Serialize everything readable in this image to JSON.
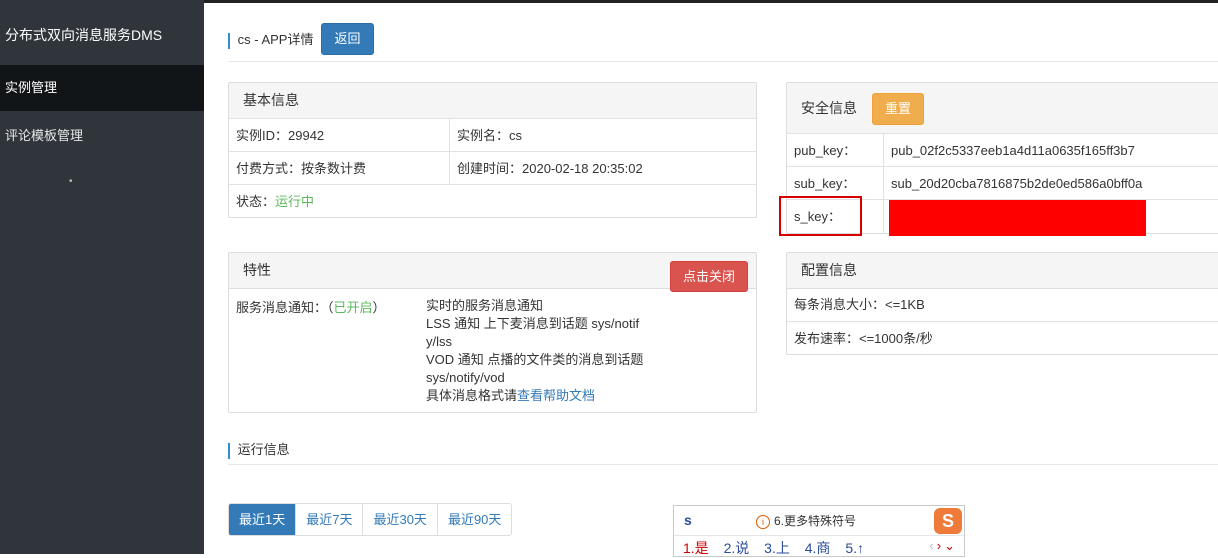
{
  "sidebar": {
    "title": "分布式双向消息服务DMS",
    "items": [
      {
        "label": "实例管理",
        "active": true
      },
      {
        "label": "评论模板管理",
        "active": false
      }
    ],
    "dot": "•"
  },
  "header": {
    "title": "cs - APP详情",
    "back_label": "返回"
  },
  "basic": {
    "title": "基本信息",
    "instance_id": "实例ID：29942",
    "instance_name": "实例名：cs",
    "billing": "付费方式：按条数计费",
    "created": "创建时间：2020-02-18 20:35:02",
    "status_label": "状态：",
    "status_value": "运行中"
  },
  "security": {
    "title": "安全信息",
    "reset_label": "重置",
    "rows": [
      {
        "key": "pub_key：",
        "value": "pub_02f2c5337eeb1a4d11a0635f165ff3b7"
      },
      {
        "key": "sub_key：",
        "value": "sub_20d20cba7816875b2de0ed586a0bff0a"
      },
      {
        "key": "s_key：",
        "value": ""
      }
    ]
  },
  "features": {
    "title": "特性",
    "label": "服务消息通知：（",
    "state": "已开启",
    "label_end": "）",
    "desc": [
      "实时的服务消息通知",
      "LSS 通知 上下麦消息到话题 sys/notif",
      "y/lss",
      "VOD 通知 点播的文件类的消息到话题",
      "sys/notify/vod"
    ],
    "desc_last_prefix": "具体消息格式请",
    "help_link": "查看帮助文档",
    "close_label": "点击关闭"
  },
  "config": {
    "title": "配置信息",
    "max_size": "每条消息大小：<=1KB",
    "rate": "发布速率：<=1000条/秒"
  },
  "runtime": {
    "title": "运行信息",
    "ranges": [
      "最近1天",
      "最近7天",
      "最近30天",
      "最近90天"
    ],
    "active_range": 0
  },
  "ime": {
    "input": "s",
    "hint": "6.更多特殊符号",
    "hint_icon": "i",
    "logo": "S",
    "candidates": [
      "1.是",
      "2.说",
      "3.上",
      "4.商",
      "5.↑"
    ],
    "nav": [
      "‹",
      "›",
      "⌄"
    ]
  }
}
